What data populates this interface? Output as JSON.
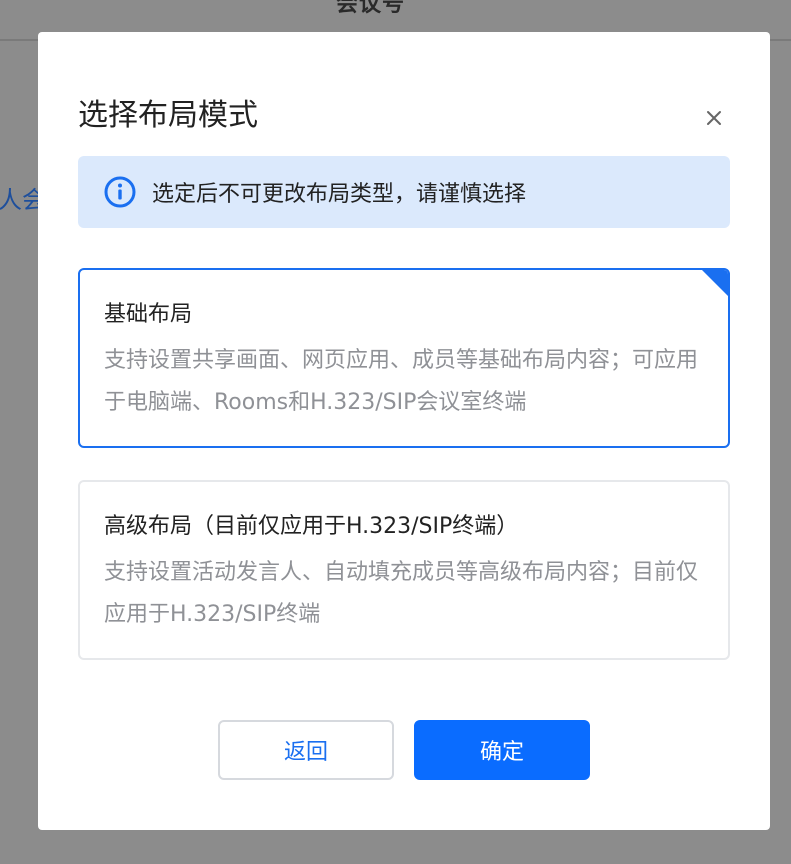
{
  "background": {
    "title": "会议号",
    "side_text": "人会"
  },
  "dialog": {
    "title": "选择布局模式",
    "close_icon": "close-icon",
    "notice": {
      "icon": "info-icon",
      "text": "选定后不可更改布局类型，请谨慎选择"
    },
    "options": [
      {
        "title": "基础布局",
        "description": "支持设置共享画面、网页应用、成员等基础布局内容；可应用于电脑端、Rooms和H.323/SIP会议室终端",
        "selected": true
      },
      {
        "title": "高级布局（目前仅应用于H.323/SIP终端）",
        "description": "支持设置活动发言人、自动填充成员等高级布局内容；目前仅应用于H.323/SIP终端",
        "selected": false
      }
    ],
    "buttons": {
      "back": "返回",
      "confirm": "确定"
    }
  },
  "colors": {
    "accent": "#0a6cff",
    "selected_border": "#1a6ff0",
    "notice_bg": "#dbe9fc",
    "overlay": "#8c8c8c"
  }
}
